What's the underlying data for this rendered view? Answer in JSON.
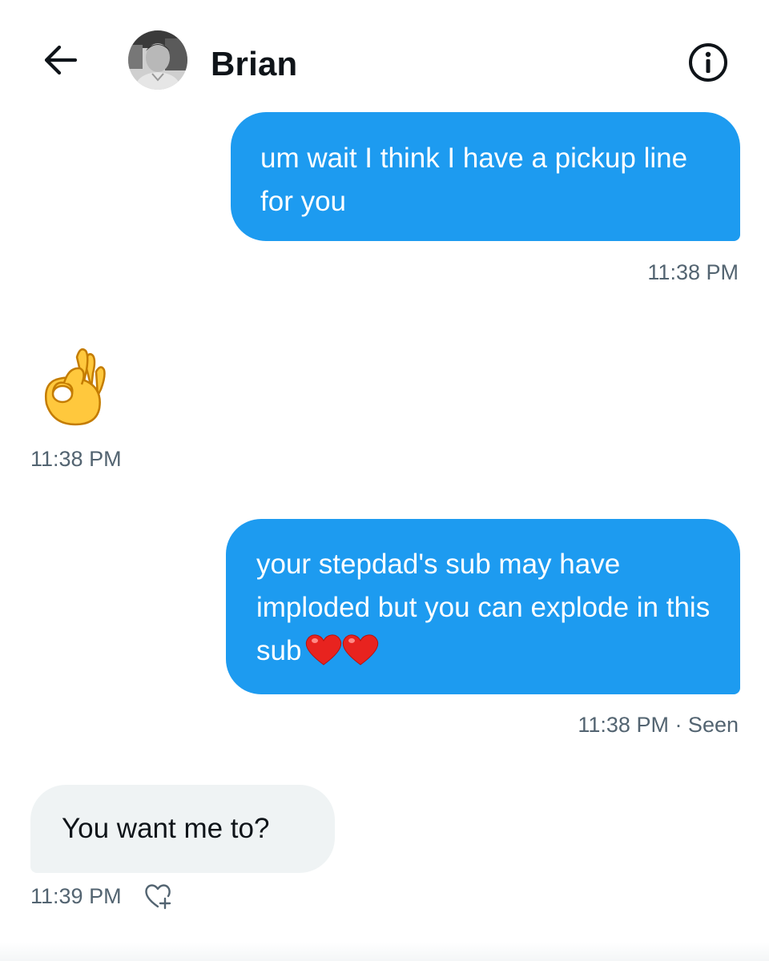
{
  "header": {
    "contact_name": "Brian"
  },
  "icons": {
    "back": "arrow-left-icon",
    "avatar": "profile-photo",
    "info": "info-circle-icon",
    "ok_hand": "ok-hand-emoji",
    "hearts": "red-heart-emoji",
    "react": "heart-plus-icon"
  },
  "messages": [
    {
      "direction": "sent",
      "text": "um wait I think I have a pickup line for you",
      "time": "11:38 PM"
    },
    {
      "direction": "received",
      "text": "👌",
      "time": "11:38 PM"
    },
    {
      "direction": "sent",
      "text": "your stepdad's sub may have imploded but you can explode in this sub",
      "emoji": "❤❤",
      "time": "11:38 PM · Seen"
    },
    {
      "direction": "received",
      "text": "You want me to?",
      "time": "11:39 PM"
    }
  ],
  "colors": {
    "sent_bubble": "#1d9bf0",
    "received_bubble": "#eff3f4",
    "meta_text": "#536471",
    "primary_text": "#0f1419"
  }
}
